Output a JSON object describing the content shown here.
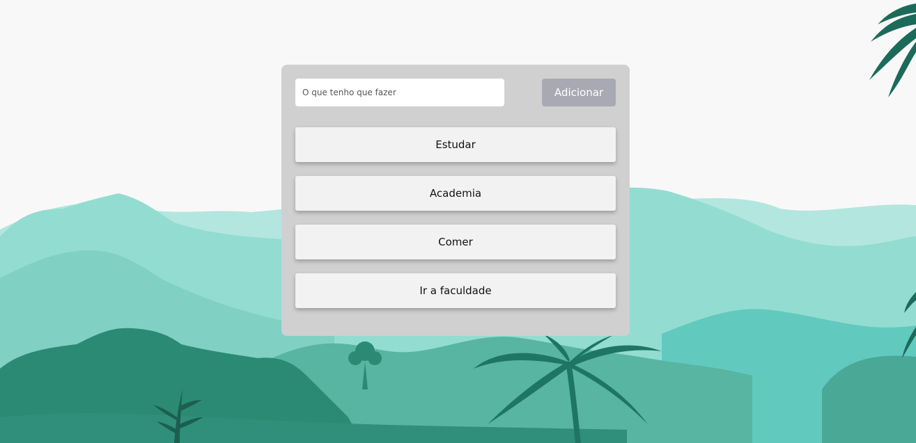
{
  "form": {
    "input_placeholder": "O que tenho que fazer",
    "input_value": "",
    "add_label": "Adicionar"
  },
  "tasks": [
    {
      "label": "Estudar"
    },
    {
      "label": "Academia"
    },
    {
      "label": "Comer"
    },
    {
      "label": "Ir a faculdade"
    }
  ],
  "colors": {
    "background": "#f8f8f8",
    "card": "#d0d0d0",
    "task_item": "#f2f2f2",
    "add_button": "#a9a9b3",
    "mountain_light": "#b3e6df",
    "mountain_mid": "#93dcd1",
    "mountain_teal": "#62c9bf",
    "forest_mid": "#57b5a2",
    "forest_dark": "#2b8a74",
    "foliage_darkest": "#1c6b5a"
  }
}
